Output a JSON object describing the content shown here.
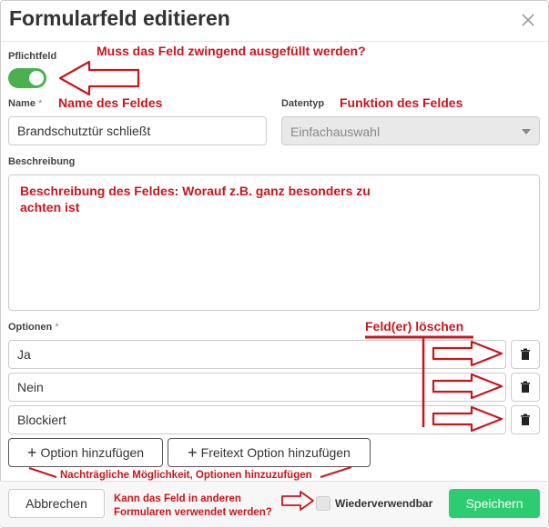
{
  "dialog": {
    "title": "Formularfeld editieren"
  },
  "fields": {
    "mandatory_label": "Pflichtfeld",
    "mandatory_on": true,
    "name_label": "Name",
    "required_mark": "*",
    "name_value": "Brandschutztür schließt",
    "datatype_label": "Datentyp",
    "datatype_value": "Einfachauswahl",
    "description_label": "Beschreibung",
    "description_value": "",
    "options_label": "Optionen",
    "options": [
      {
        "value": "Ja"
      },
      {
        "value": "Nein"
      },
      {
        "value": "Blockiert"
      }
    ]
  },
  "buttons": {
    "add_option": "Option hinzufügen",
    "add_freetext_option": "Freitext Option hinzufügen",
    "cancel": "Abbrechen",
    "save": "Speichern",
    "reusable_label": "Wiederverwendbar"
  },
  "annotations": {
    "mandatory": "Muss das Feld zwingend ausgefüllt werden?",
    "name": "Name des Feldes",
    "datatype": "Funktion des Feldes",
    "description_line1": "Beschreibung des Feldes: Worauf z.B. ganz besonders zu",
    "description_line2": "achten ist",
    "delete_fields": "Feld(er) löschen",
    "add_later": "Nachträgliche Möglichkeit, Optionen hinzuzufügen",
    "reuse_line1": "Kann das Feld in anderen",
    "reuse_line2": "Formularen verwendet werden?"
  },
  "colors": {
    "annotation": "#c8161d",
    "toggle": "#4caf50",
    "save": "#2ecc71"
  },
  "icons": {
    "close": "close-icon",
    "trash": "trash-icon",
    "plus": "plus-icon",
    "caret": "chevron-down-icon"
  }
}
